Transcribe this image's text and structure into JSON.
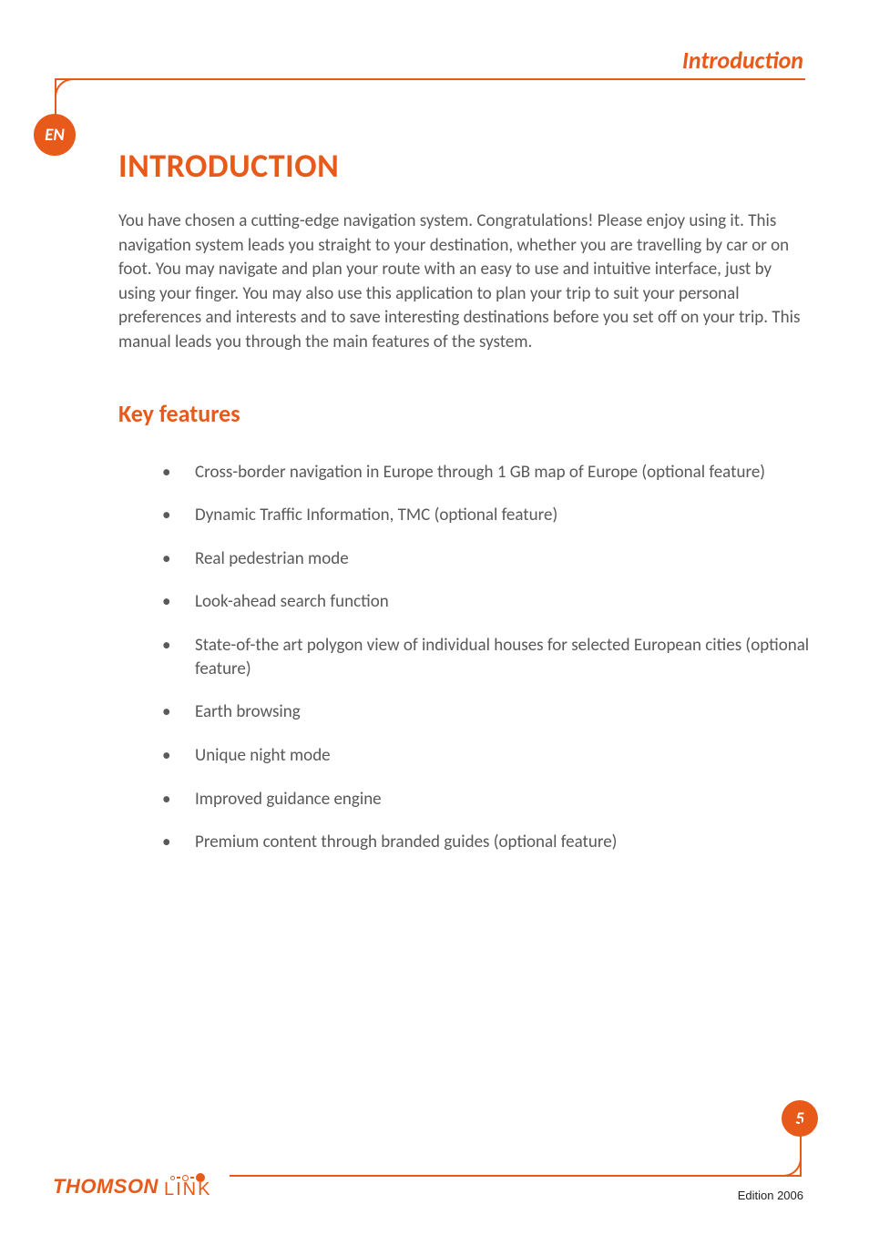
{
  "header": {
    "section_title": "Introduction",
    "language_badge": "EN"
  },
  "content": {
    "heading": "INTRODUCTION",
    "intro_paragraph": "You have chosen a cutting-edge navigation system. Congratulations! Please enjoy using it. This navigation system leads you straight to your destination, whether you are travelling by car or on foot. You may navigate and plan your route with an easy to use and intuitive interface, just by using your finger. You may also use this application to plan your trip to suit your personal preferences and interests and to save interesting destinations before you set off on your trip. This manual leads you through the main features of the system.",
    "subheading": "Key features",
    "features": [
      "Cross-border navigation in Europe through 1 GB map of Europe (optional feature)",
      "Dynamic Traffic Information, TMC (optional feature)",
      "Real pedestrian mode",
      "Look-ahead search function",
      "State-of-the art polygon view of individual houses for selected European cities (optional feature)",
      "Earth browsing",
      "Unique night mode",
      "Improved guidance engine",
      "Premium content through branded guides (optional feature)"
    ]
  },
  "footer": {
    "page_number": "5",
    "brand_primary": "THOMSON",
    "brand_secondary": "LINK",
    "edition": "Edition 2006"
  }
}
